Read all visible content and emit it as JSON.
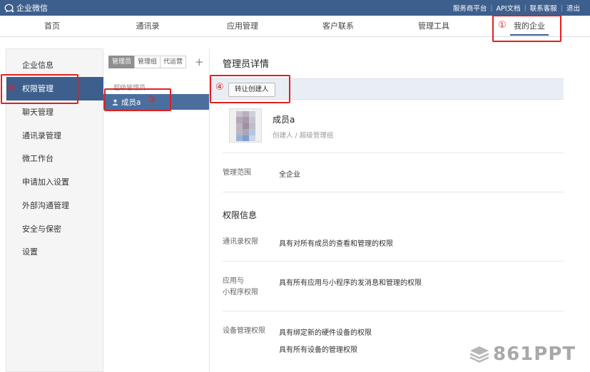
{
  "topbar": {
    "brand": "企业微信",
    "links": [
      "服务商平台",
      "API文档",
      "联系客服",
      "退出"
    ]
  },
  "nav": {
    "items": [
      "首页",
      "通讯录",
      "应用管理",
      "客户联系",
      "管理工具",
      "我的企业"
    ],
    "active": "我的企业"
  },
  "sidebar": {
    "items": [
      "企业信息",
      "权限管理",
      "聊天管理",
      "通讯录管理",
      "微工作台",
      "申请加入设置",
      "外部沟通管理",
      "安全与保密",
      "设置"
    ],
    "active": "权限管理"
  },
  "middle": {
    "tabs": [
      "管理员",
      "管理组",
      "代运营"
    ],
    "add_label": "+",
    "group_title": "超级管理员",
    "member": "成员a"
  },
  "detail": {
    "title": "管理员详情",
    "transfer_button": "转让创建人",
    "name": "成员a",
    "role": "创建人 / 超级管理组",
    "scope_label": "管理范围",
    "scope_value": "全企业",
    "permission_title": "权限信息",
    "permissions": [
      {
        "label": "通讯录权限",
        "value": "具有对所有成员的查看和管理的权限"
      },
      {
        "label_line1": "应用与",
        "label_line2": "小程序权限",
        "value": "具有所有应用与小程序的发消息和管理的权限"
      },
      {
        "label": "设备管理权限",
        "value1": "具有绑定新的硬件设备的权限",
        "value2": "具有所有设备的管理权限"
      }
    ]
  },
  "annotations": [
    "①",
    "②",
    "③",
    "④"
  ],
  "watermark": "861PPT",
  "colors": {
    "brand": "#3d5f8d",
    "annotation": "#e02020"
  }
}
